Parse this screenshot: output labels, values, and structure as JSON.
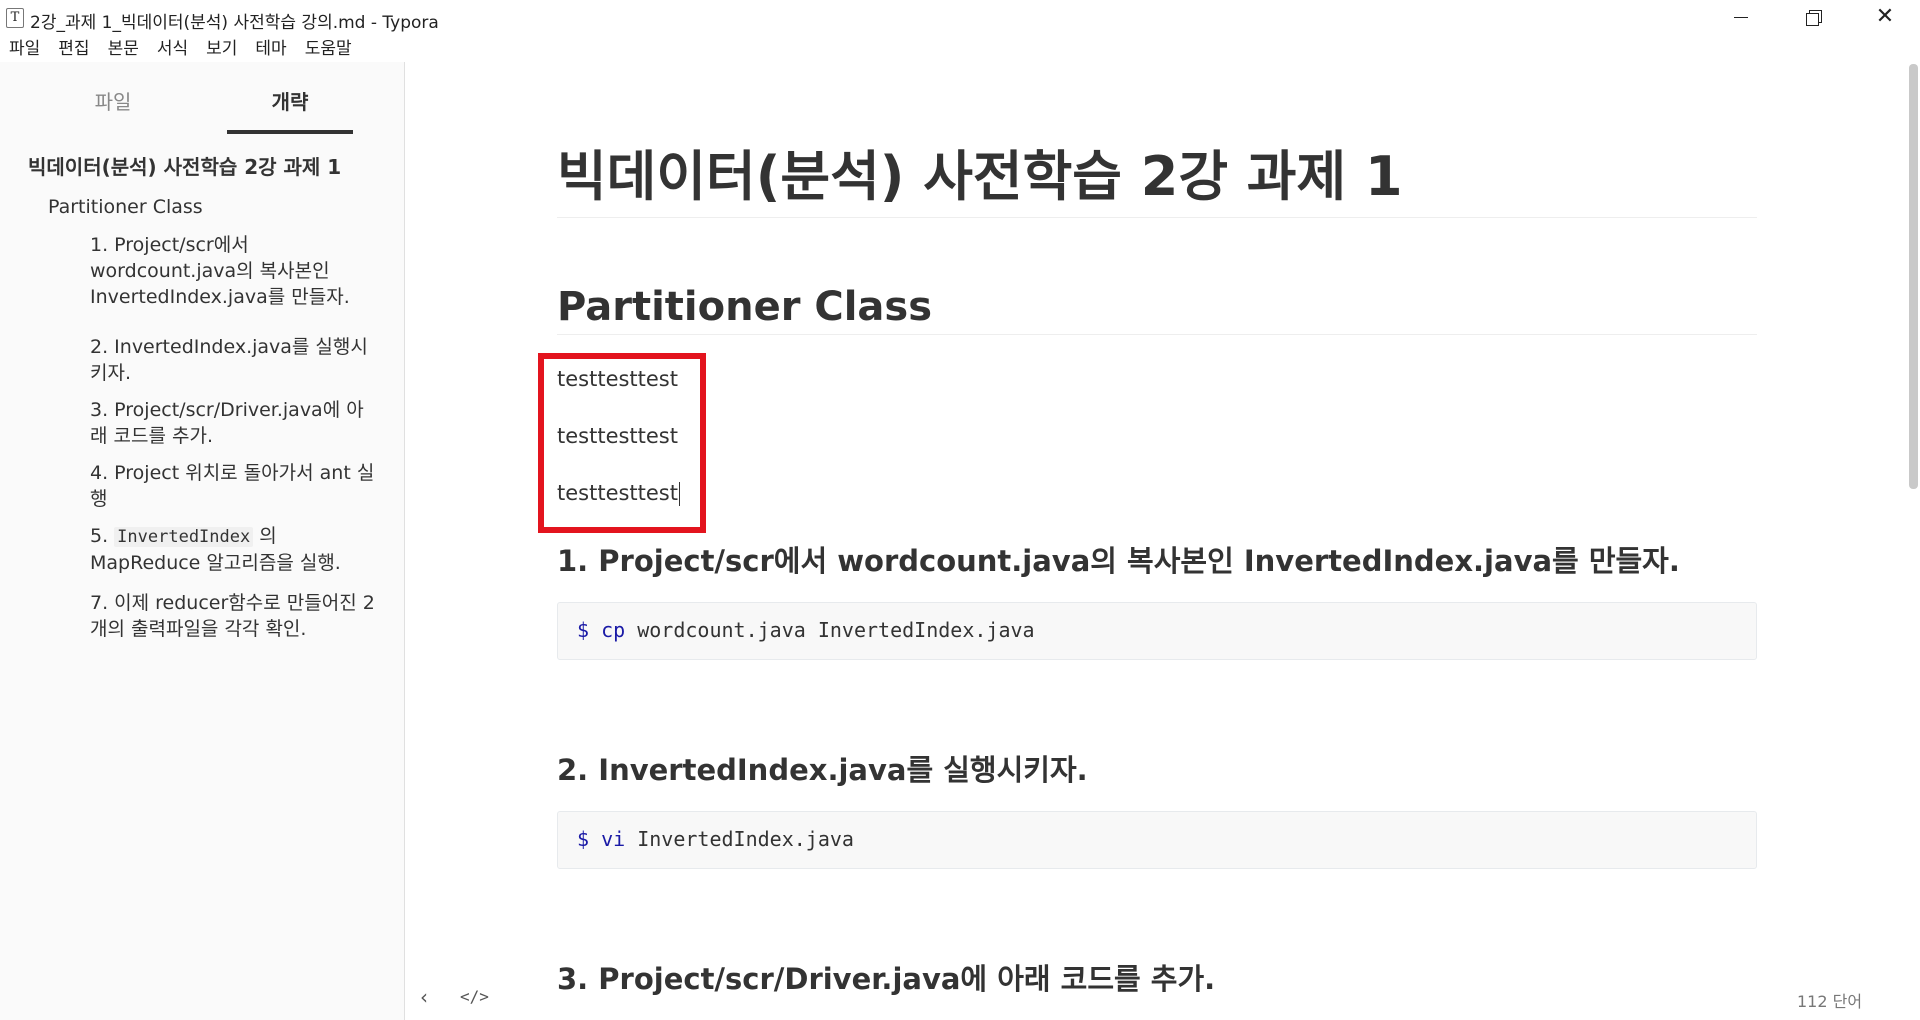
{
  "window": {
    "app_icon_glyph": "T",
    "title": "2강_과제 1_빅데이터(분석) 사전학습 강의.md - Typora",
    "close_glyph": "✕"
  },
  "menu": [
    "파일",
    "편집",
    "본문",
    "서식",
    "보기",
    "테마",
    "도움말"
  ],
  "sidebar": {
    "tabs": {
      "files": "파일",
      "outline": "개략"
    },
    "active_tab": "outline",
    "outline": {
      "h1": "빅데이터(분석) 사전학습 2강 과제 1",
      "h2": "Partitioner Class",
      "items": [
        "1. Project/scr에서 wordcount.java의 복사본인 InvertedIndex.java를 만들자.",
        "2. InvertedIndex.java를 실행시키자.",
        "3. Project/scr/Driver.java에 아래 코드를 추가.",
        "4. Project 위치로 돌아가서 ant 실행"
      ],
      "item5": {
        "prefix": "5. ",
        "code": "InvertedIndex",
        "suffix": " 의 MapReduce 알고리즘을 실행."
      },
      "item7": "7. 이제 reducer함수로 만들어진 2개의 출력파일을 각각 확인."
    },
    "footer": {
      "back_glyph": "‹",
      "source_glyph": "</>"
    }
  },
  "document": {
    "h1": "빅데이터(분석) 사전학습 2강 과제 1",
    "h2": "Partitioner Class",
    "paragraphs": [
      "testtesttest",
      "testtesttest",
      "testtesttest"
    ],
    "sections": [
      {
        "heading": "1. Project/scr에서 wordcount.java의 복사본인 InvertedIndex.java를 만들자.",
        "code": {
          "prompt": "$",
          "cmd": "cp",
          "args": " wordcount.java InvertedIndex.java"
        }
      },
      {
        "heading": "2. InvertedIndex.java를 실행시키자.",
        "code": {
          "prompt": "$",
          "cmd": "vi",
          "args": " InvertedIndex.java"
        }
      },
      {
        "heading": "3. Project/scr/Driver.java에 아래 코드를 추가."
      }
    ]
  },
  "status": {
    "word_count": "112 단어"
  },
  "colors": {
    "highlight_box": "#e3141e",
    "code_keyword": "#1a1aa6",
    "sidebar_bg": "#fafafa"
  }
}
